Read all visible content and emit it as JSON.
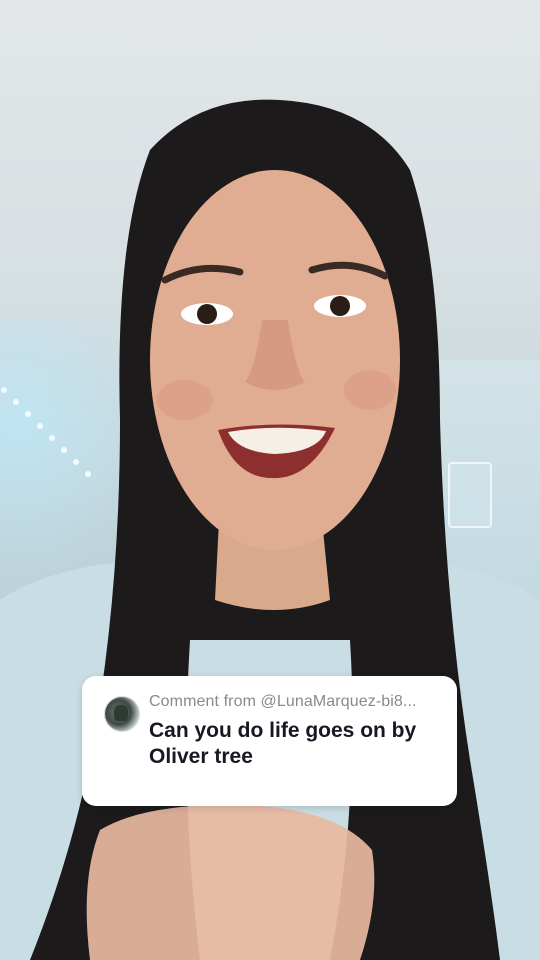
{
  "comment": {
    "header": "Comment from @LunaMarquez-bi8...",
    "text": "Can you do life goes on by Oliver tree"
  }
}
